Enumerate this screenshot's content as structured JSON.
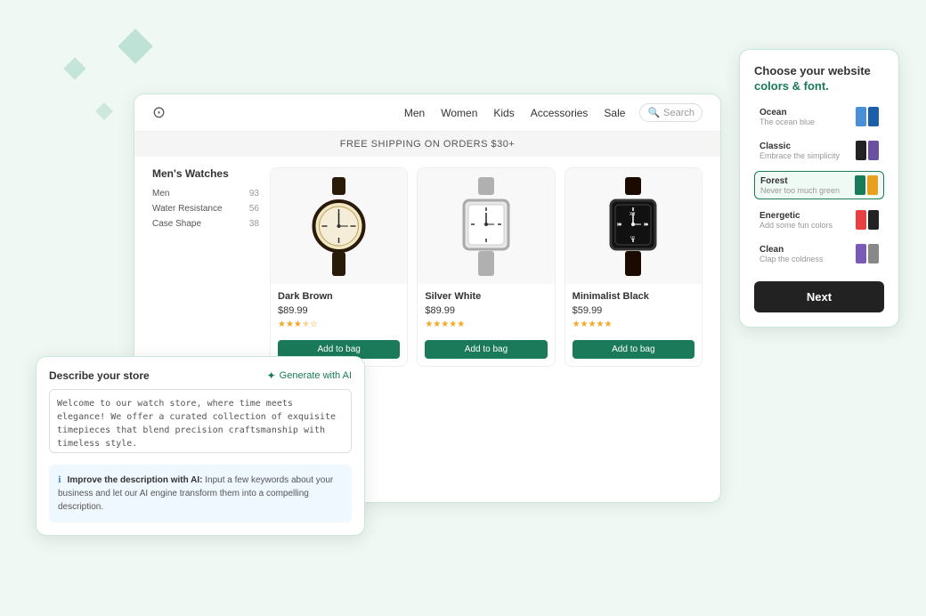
{
  "decorative": {
    "diamonds": [
      "diamond-1",
      "diamond-2",
      "diamond-3"
    ]
  },
  "website_preview": {
    "logo": "⊙",
    "nav_links": [
      "Men",
      "Women",
      "Kids",
      "Accessories",
      "Sale"
    ],
    "search_placeholder": "Search",
    "promo_banner": "FREE SHIPPING ON ORDERS $30+",
    "sidebar": {
      "title": "Men's Watches",
      "filters": [
        {
          "label": "Men",
          "count": "93"
        },
        {
          "label": "Water Resistance",
          "count": "56"
        },
        {
          "label": "Case Shape",
          "count": "38"
        }
      ]
    },
    "products": [
      {
        "name": "Dark Brown",
        "price": "$89.99",
        "stars": 3.5,
        "style": "round-brown"
      },
      {
        "name": "Silver White",
        "price": "$89.99",
        "stars": 5,
        "style": "square-silver"
      },
      {
        "name": "Minimalist Black",
        "price": "$59.99",
        "stars": 5,
        "style": "square-black"
      }
    ],
    "add_to_bag_label": "Add to bag"
  },
  "describe_store": {
    "title": "Describe your store",
    "generate_label": "Generate with AI",
    "textarea_value": "Welcome to our watch store, where time meets elegance! We offer a curated collection of exquisite timepieces that blend precision craftsmanship with timeless style.",
    "improve_title": "Improve the description with AI:",
    "improve_text": "Input a few keywords about your business and let our AI engine transform them into a compelling description."
  },
  "colors_panel": {
    "title": "Choose your website",
    "subtitle": "colors & font.",
    "options": [
      {
        "name": "Ocean",
        "desc": "The ocean blue",
        "swatches": [
          "#4a90d9",
          "#1a5fa8"
        ],
        "selected": false
      },
      {
        "name": "Classic",
        "desc": "Embrace the simplicity",
        "swatches": [
          "#222222",
          "#6b4fa0"
        ],
        "selected": false
      },
      {
        "name": "Forest",
        "desc": "Never too much green",
        "swatches": [
          "#1a7a5a",
          "#e8a020"
        ],
        "selected": true
      },
      {
        "name": "Energetic",
        "desc": "Add some fun colors",
        "swatches": [
          "#e84040",
          "#222222"
        ],
        "selected": false
      },
      {
        "name": "Clean",
        "desc": "Clap the coldness",
        "swatches": [
          "#7a5ab8",
          "#888888"
        ],
        "selected": false
      }
    ],
    "next_label": "Next"
  }
}
